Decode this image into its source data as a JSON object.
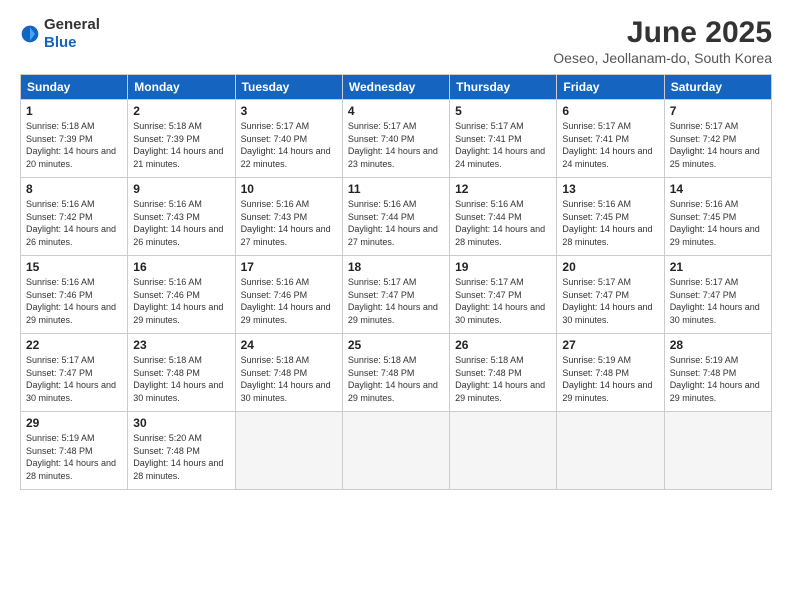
{
  "logo": {
    "general": "General",
    "blue": "Blue"
  },
  "title": "June 2025",
  "subtitle": "Oeseo, Jeollanam-do, South Korea",
  "days": [
    "Sunday",
    "Monday",
    "Tuesday",
    "Wednesday",
    "Thursday",
    "Friday",
    "Saturday"
  ],
  "weeks": [
    [
      {
        "day": "1",
        "sunrise": "5:18 AM",
        "sunset": "7:39 PM",
        "daylight": "14 hours and 20 minutes."
      },
      {
        "day": "2",
        "sunrise": "5:18 AM",
        "sunset": "7:39 PM",
        "daylight": "14 hours and 21 minutes."
      },
      {
        "day": "3",
        "sunrise": "5:17 AM",
        "sunset": "7:40 PM",
        "daylight": "14 hours and 22 minutes."
      },
      {
        "day": "4",
        "sunrise": "5:17 AM",
        "sunset": "7:40 PM",
        "daylight": "14 hours and 23 minutes."
      },
      {
        "day": "5",
        "sunrise": "5:17 AM",
        "sunset": "7:41 PM",
        "daylight": "14 hours and 24 minutes."
      },
      {
        "day": "6",
        "sunrise": "5:17 AM",
        "sunset": "7:41 PM",
        "daylight": "14 hours and 24 minutes."
      },
      {
        "day": "7",
        "sunrise": "5:17 AM",
        "sunset": "7:42 PM",
        "daylight": "14 hours and 25 minutes."
      }
    ],
    [
      {
        "day": "8",
        "sunrise": "5:16 AM",
        "sunset": "7:42 PM",
        "daylight": "14 hours and 26 minutes."
      },
      {
        "day": "9",
        "sunrise": "5:16 AM",
        "sunset": "7:43 PM",
        "daylight": "14 hours and 26 minutes."
      },
      {
        "day": "10",
        "sunrise": "5:16 AM",
        "sunset": "7:43 PM",
        "daylight": "14 hours and 27 minutes."
      },
      {
        "day": "11",
        "sunrise": "5:16 AM",
        "sunset": "7:44 PM",
        "daylight": "14 hours and 27 minutes."
      },
      {
        "day": "12",
        "sunrise": "5:16 AM",
        "sunset": "7:44 PM",
        "daylight": "14 hours and 28 minutes."
      },
      {
        "day": "13",
        "sunrise": "5:16 AM",
        "sunset": "7:45 PM",
        "daylight": "14 hours and 28 minutes."
      },
      {
        "day": "14",
        "sunrise": "5:16 AM",
        "sunset": "7:45 PM",
        "daylight": "14 hours and 29 minutes."
      }
    ],
    [
      {
        "day": "15",
        "sunrise": "5:16 AM",
        "sunset": "7:46 PM",
        "daylight": "14 hours and 29 minutes."
      },
      {
        "day": "16",
        "sunrise": "5:16 AM",
        "sunset": "7:46 PM",
        "daylight": "14 hours and 29 minutes."
      },
      {
        "day": "17",
        "sunrise": "5:16 AM",
        "sunset": "7:46 PM",
        "daylight": "14 hours and 29 minutes."
      },
      {
        "day": "18",
        "sunrise": "5:17 AM",
        "sunset": "7:47 PM",
        "daylight": "14 hours and 29 minutes."
      },
      {
        "day": "19",
        "sunrise": "5:17 AM",
        "sunset": "7:47 PM",
        "daylight": "14 hours and 30 minutes."
      },
      {
        "day": "20",
        "sunrise": "5:17 AM",
        "sunset": "7:47 PM",
        "daylight": "14 hours and 30 minutes."
      },
      {
        "day": "21",
        "sunrise": "5:17 AM",
        "sunset": "7:47 PM",
        "daylight": "14 hours and 30 minutes."
      }
    ],
    [
      {
        "day": "22",
        "sunrise": "5:17 AM",
        "sunset": "7:47 PM",
        "daylight": "14 hours and 30 minutes."
      },
      {
        "day": "23",
        "sunrise": "5:18 AM",
        "sunset": "7:48 PM",
        "daylight": "14 hours and 30 minutes."
      },
      {
        "day": "24",
        "sunrise": "5:18 AM",
        "sunset": "7:48 PM",
        "daylight": "14 hours and 30 minutes."
      },
      {
        "day": "25",
        "sunrise": "5:18 AM",
        "sunset": "7:48 PM",
        "daylight": "14 hours and 29 minutes."
      },
      {
        "day": "26",
        "sunrise": "5:18 AM",
        "sunset": "7:48 PM",
        "daylight": "14 hours and 29 minutes."
      },
      {
        "day": "27",
        "sunrise": "5:19 AM",
        "sunset": "7:48 PM",
        "daylight": "14 hours and 29 minutes."
      },
      {
        "day": "28",
        "sunrise": "5:19 AM",
        "sunset": "7:48 PM",
        "daylight": "14 hours and 29 minutes."
      }
    ],
    [
      {
        "day": "29",
        "sunrise": "5:19 AM",
        "sunset": "7:48 PM",
        "daylight": "14 hours and 28 minutes."
      },
      {
        "day": "30",
        "sunrise": "5:20 AM",
        "sunset": "7:48 PM",
        "daylight": "14 hours and 28 minutes."
      },
      null,
      null,
      null,
      null,
      null
    ]
  ]
}
